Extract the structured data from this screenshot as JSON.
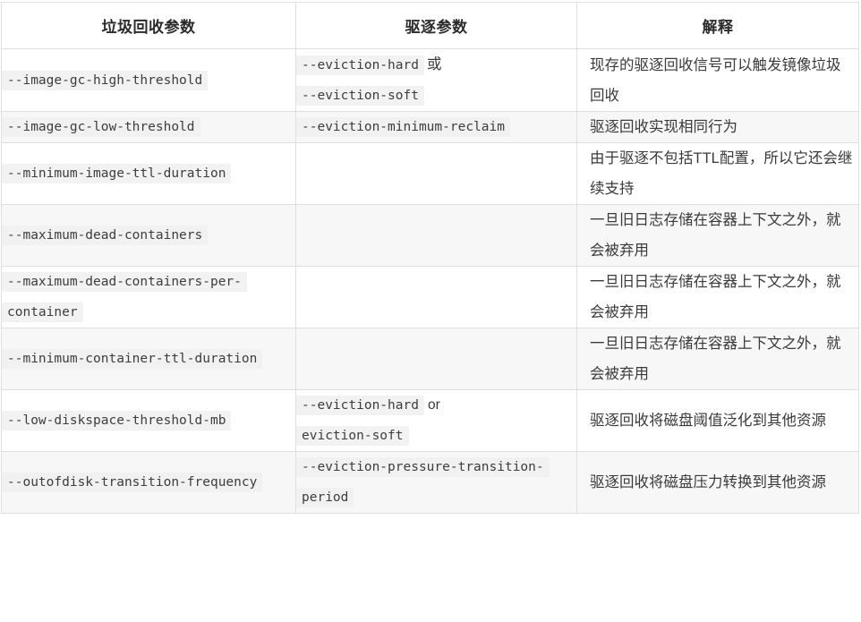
{
  "table": {
    "columns": [
      {
        "key": "gc_param",
        "label": "垃圾回收参数"
      },
      {
        "key": "evict_param",
        "label": "驱逐参数"
      },
      {
        "key": "explanation",
        "label": "解释"
      }
    ],
    "rows": [
      {
        "gc_param": "--image-gc-high-threshold",
        "evict_param_code_1": "--eviction-hard",
        "evict_param_joiner": "或",
        "evict_param_code_2": "--eviction-soft",
        "explanation": "现存的驱逐回收信号可以触发镜像垃圾回收"
      },
      {
        "gc_param": "--image-gc-low-threshold",
        "evict_param_code_1": "--eviction-minimum-reclaim",
        "evict_param_joiner": "",
        "evict_param_code_2": "",
        "explanation": "驱逐回收实现相同行为"
      },
      {
        "gc_param": "--minimum-image-ttl-duration",
        "evict_param_code_1": "",
        "evict_param_joiner": "",
        "evict_param_code_2": "",
        "explanation": "由于驱逐不包括TTL配置，所以它还会继续支持"
      },
      {
        "gc_param": "--maximum-dead-containers",
        "evict_param_code_1": "",
        "evict_param_joiner": "",
        "evict_param_code_2": "",
        "explanation": "一旦旧日志存储在容器上下文之外，就会被弃用"
      },
      {
        "gc_param": "--maximum-dead-containers-per-container",
        "evict_param_code_1": "",
        "evict_param_joiner": "",
        "evict_param_code_2": "",
        "explanation": "一旦旧日志存储在容器上下文之外，就会被弃用"
      },
      {
        "gc_param": "--minimum-container-ttl-duration",
        "evict_param_code_1": "",
        "evict_param_joiner": "",
        "evict_param_code_2": "",
        "explanation": "一旦旧日志存储在容器上下文之外，就会被弃用"
      },
      {
        "gc_param": "--low-diskspace-threshold-mb",
        "evict_param_code_1": "--eviction-hard",
        "evict_param_joiner": "or",
        "evict_param_code_2": "eviction-soft",
        "explanation": "驱逐回收将磁盘阈值泛化到其他资源"
      },
      {
        "gc_param": "--outofdisk-transition-frequency",
        "evict_param_code_1": "--eviction-pressure-transition-period",
        "evict_param_joiner": "",
        "evict_param_code_2": "",
        "explanation": "驱逐回收将磁盘压力转换到其他资源"
      }
    ]
  },
  "colors": {
    "border": "#dfdfdf",
    "row_stripe": "#f7f7f7",
    "code_background": "#f2f2f2",
    "text": "#3a3a3a",
    "header_text": "#2b2b2b"
  }
}
